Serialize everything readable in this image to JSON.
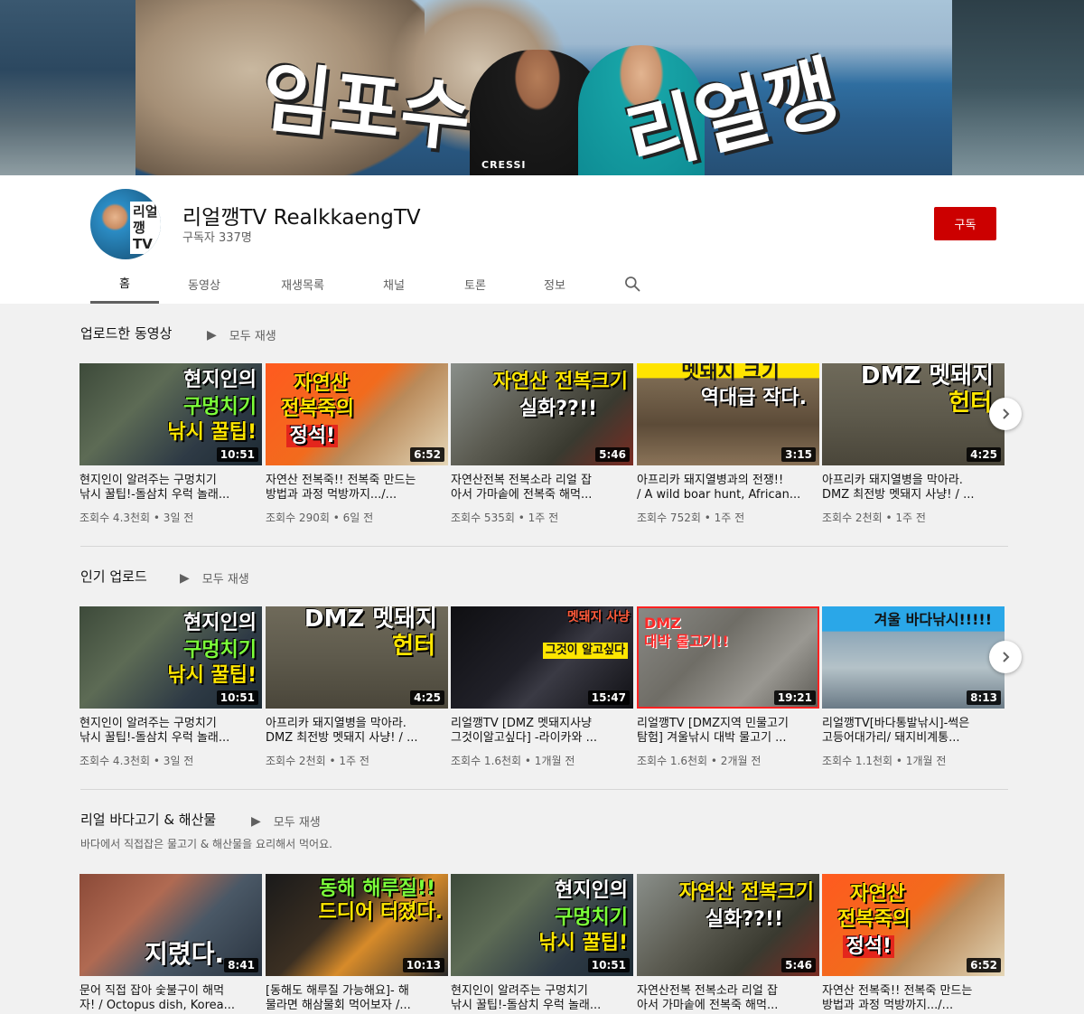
{
  "banner": {
    "title_left": "임포수",
    "title_right": "리얼깽",
    "brand_label": "CRESSI"
  },
  "channel": {
    "avatar_text": "리얼깽TV",
    "name": "리얼깽TV RealkkaengTV",
    "subscribers": "구독자 337명",
    "subscribe_label": "구독"
  },
  "tabs": [
    {
      "label": "홈"
    },
    {
      "label": "동영상"
    },
    {
      "label": "재생목록"
    },
    {
      "label": "채널"
    },
    {
      "label": "토론"
    },
    {
      "label": "정보"
    }
  ],
  "sections": [
    {
      "title": "업로드한 동영상",
      "play_all": "모두 재생",
      "videos": [
        {
          "thumb_lines": [
            "현지인의",
            "구멍치기",
            "낚시 꿀팁!"
          ],
          "duration": "10:51",
          "title1": "현지인이 알려주는 구멍치기",
          "title2": "낚시 꿀팁!-돌삼치 우럭 놀래...",
          "meta": "조회수 4.3천회 • 3일 전"
        },
        {
          "thumb_lines": [
            "자연산",
            "전복죽의",
            "정석!"
          ],
          "duration": "6:52",
          "title1": "자연산 전복죽!! 전복죽 만드는",
          "title2": "방법과 과정 먹방까지.../...",
          "meta": "조회수 290회 • 6일 전"
        },
        {
          "thumb_lines": [
            "자연산 전복크기",
            "실화??!!"
          ],
          "duration": "5:46",
          "title1": "자연산전복 전복소라 리얼 잡",
          "title2": "아서 가마솥에 전복죽 해먹...",
          "meta": "조회수 535회 • 1주 전"
        },
        {
          "thumb_lines": [
            "멧돼지 크기",
            "역대급 작다."
          ],
          "duration": "3:15",
          "title1": "아프리카 돼지열병과의 전쟁!!",
          "title2": "/ A wild boar hunt, African...",
          "meta": "조회수 752회 • 1주 전"
        },
        {
          "thumb_lines": [
            "DMZ 멧돼지",
            "헌터"
          ],
          "duration": "4:25",
          "title1": "아프리카 돼지열병을 막아라.",
          "title2": "DMZ 최전방 멧돼지 사냥! / ...",
          "meta": "조회수 2천회 • 1주 전"
        }
      ]
    },
    {
      "title": "인기 업로드",
      "play_all": "모두 재생",
      "videos": [
        {
          "thumb_lines": [
            "현지인의",
            "구멍치기",
            "낚시 꿀팁!"
          ],
          "duration": "10:51",
          "title1": "현지인이 알려주는 구멍치기",
          "title2": "낚시 꿀팁!-돌삼치 우럭 놀래...",
          "meta": "조회수 4.3천회 • 3일 전"
        },
        {
          "thumb_lines": [
            "DMZ 멧돼지",
            "헌터"
          ],
          "duration": "4:25",
          "title1": "아프리카 돼지열병을 막아라.",
          "title2": "DMZ 최전방 멧돼지 사냥! / ...",
          "meta": "조회수 2천회 • 1주 전"
        },
        {
          "thumb_lines": [
            "멧돼지 사냥",
            "그것이 알고싶다"
          ],
          "duration": "15:47",
          "title1": "리얼깽TV [DMZ 멧돼지사냥",
          "title2": "그것이알고싶다] -라이카와 ...",
          "meta": "조회수 1.6천회 • 1개월 전"
        },
        {
          "thumb_lines": [
            "DMZ",
            "대박 물고기!!"
          ],
          "duration": "19:21",
          "title1": "리얼깽TV [DMZ지역 민물고기",
          "title2": "탐험] 겨울낚시 대박 물고기 ...",
          "meta": "조회수 1.6천회 • 2개월 전"
        },
        {
          "thumb_lines": [
            "겨울 바다낚시!!!!!"
          ],
          "duration": "8:13",
          "title1": "리얼깽TV[바다통발낚시]-썩은",
          "title2": "고등어대가리/ 돼지비계통...",
          "meta": "조회수 1.1천회 • 1개월 전"
        }
      ]
    },
    {
      "title": "리얼 바다고기 & 해산물",
      "play_all": "모두 재생",
      "description": "바다에서 직접잡은 물고기 & 해산물을 요리해서 먹어요.",
      "videos": [
        {
          "thumb_lines": [
            "지렸다."
          ],
          "duration": "8:41",
          "title1": "문어 직접 잡아 숯불구이 해먹",
          "title2": "자! / Octopus dish, Korea..."
        },
        {
          "thumb_lines": [
            "동해 해루질!!",
            "드디어 터졌다."
          ],
          "duration": "10:13",
          "title1": "[동해도 해루질 가능해요]- 해",
          "title2": "물라면 해삼물회 먹어보자 /..."
        },
        {
          "thumb_lines": [
            "현지인의",
            "구멍치기",
            "낚시 꿀팁!"
          ],
          "duration": "10:51",
          "title1": "현지인이 알려주는 구멍치기",
          "title2": "낚시 꿀팁!-돌삼치 우럭 놀래..."
        },
        {
          "thumb_lines": [
            "자연산 전복크기",
            "실화??!!"
          ],
          "duration": "5:46",
          "title1": "자연산전복 전복소라 리얼 잡",
          "title2": "아서 가마솥에 전복죽 해먹..."
        },
        {
          "thumb_lines": [
            "자연산",
            "전복죽의",
            "정석!"
          ],
          "duration": "6:52",
          "title1": "자연산 전복죽!! 전복죽 만드는",
          "title2": "방법과 과정 먹방까지.../..."
        }
      ]
    }
  ]
}
